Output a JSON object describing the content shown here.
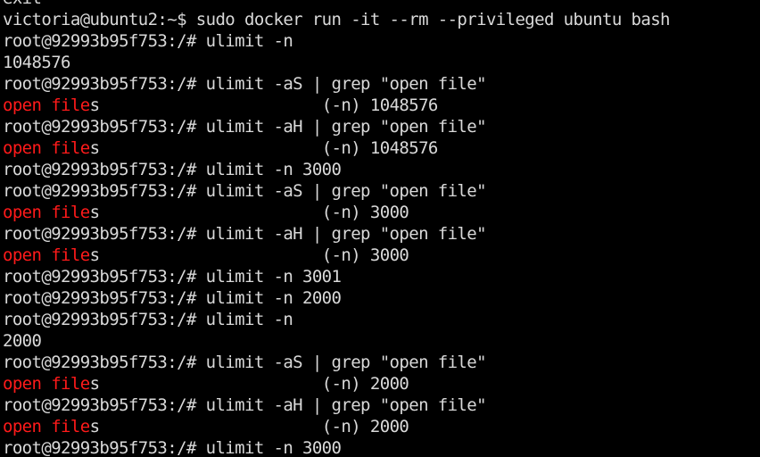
{
  "terminal": {
    "colors": {
      "background": "#000000",
      "foreground": "#d9d9d9",
      "grep_match": "#ff1a1a"
    },
    "lines": [
      {
        "type": "text",
        "text": "exit"
      },
      {
        "type": "text",
        "text": "victoria@ubuntu2:~$ sudo docker run -it --rm --privileged ubuntu bash"
      },
      {
        "type": "text",
        "text": "root@92993b95f753:/# ulimit -n"
      },
      {
        "type": "text",
        "text": "1048576"
      },
      {
        "type": "text",
        "text": "root@92993b95f753:/# ulimit -aS | grep \"open file\""
      },
      {
        "type": "match",
        "match": "open file",
        "rest": "s                       (-n) 1048576"
      },
      {
        "type": "text",
        "text": "root@92993b95f753:/# ulimit -aH | grep \"open file\""
      },
      {
        "type": "match",
        "match": "open file",
        "rest": "s                       (-n) 1048576"
      },
      {
        "type": "text",
        "text": "root@92993b95f753:/# ulimit -n 3000"
      },
      {
        "type": "text",
        "text": "root@92993b95f753:/# ulimit -aS | grep \"open file\""
      },
      {
        "type": "match",
        "match": "open file",
        "rest": "s                       (-n) 3000"
      },
      {
        "type": "text",
        "text": "root@92993b95f753:/# ulimit -aH | grep \"open file\""
      },
      {
        "type": "match",
        "match": "open file",
        "rest": "s                       (-n) 3000"
      },
      {
        "type": "text",
        "text": "root@92993b95f753:/# ulimit -n 3001"
      },
      {
        "type": "text",
        "text": "root@92993b95f753:/# ulimit -n 2000"
      },
      {
        "type": "text",
        "text": "root@92993b95f753:/# ulimit -n"
      },
      {
        "type": "text",
        "text": "2000"
      },
      {
        "type": "text",
        "text": "root@92993b95f753:/# ulimit -aS | grep \"open file\""
      },
      {
        "type": "match",
        "match": "open file",
        "rest": "s                       (-n) 2000"
      },
      {
        "type": "text",
        "text": "root@92993b95f753:/# ulimit -aH | grep \"open file\""
      },
      {
        "type": "match",
        "match": "open file",
        "rest": "s                       (-n) 2000"
      },
      {
        "type": "text",
        "text": "root@92993b95f753:/# ulimit -n 3000"
      }
    ]
  }
}
